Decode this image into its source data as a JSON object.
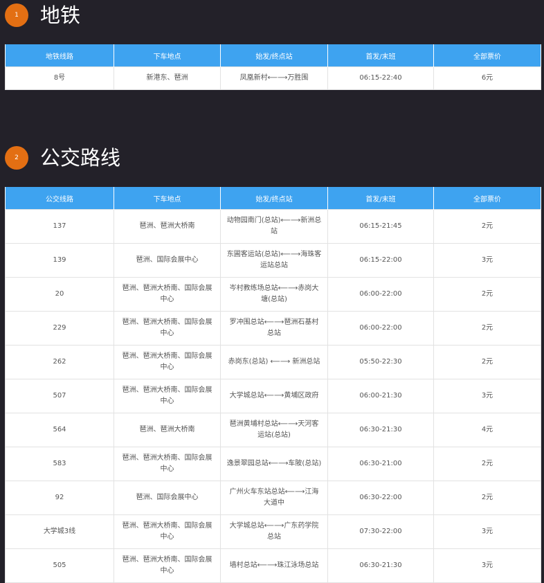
{
  "metro": {
    "badge": "1",
    "title": "地铁",
    "headers": [
      "地铁线路",
      "下车地点",
      "始发/终点站",
      "首发/末班",
      "全部票价"
    ],
    "rows": [
      [
        "8号",
        "新港东、琶洲",
        "凤凰新村⟵⟶万胜围",
        "06:15-22:40",
        "6元"
      ]
    ]
  },
  "bus": {
    "badge": "2",
    "title": "公交路线",
    "headers": [
      "公交线路",
      "下车地点",
      "始发/终点站",
      "首发/末班",
      "全部票价"
    ],
    "rows": [
      [
        "137",
        "琶洲、琶洲大桥南",
        "动物园南门(总站)⟵⟶新洲总站",
        "06:15-21:45",
        "2元"
      ],
      [
        "139",
        "琶洲、国际会展中心",
        "东圃客运站(总站)⟵⟶海珠客运站总站",
        "06:15-22:00",
        "3元"
      ],
      [
        "20",
        "琶洲、琶洲大桥南、国际会展中心",
        "岑村教练场总站⟵⟶赤岗大塘(总站)",
        "06:00-22:00",
        "2元"
      ],
      [
        "229",
        "琶洲、琶洲大桥南、国际会展中心",
        "罗冲围总站⟵⟶琶洲石基村总站",
        "06:00-22:00",
        "2元"
      ],
      [
        "262",
        "琶洲、琶洲大桥南、国际会展中心",
        "赤岗东(总站) ⟵⟶ 新洲总站",
        "05:50-22:30",
        "2元"
      ],
      [
        "507",
        "琶洲、琶洲大桥南、国际会展中心",
        "大学城总站⟵⟶黄埔区政府",
        "06:00-21:30",
        "3元"
      ],
      [
        "564",
        "琶洲、琶洲大桥南",
        "琶洲黄埔村总站⟵⟶天河客运站(总站)",
        "06:30-21:30",
        "4元"
      ],
      [
        "583",
        "琶洲、琶洲大桥南、国际会展中心",
        "逸景翠园总站⟵⟶车陂(总站)",
        "06:30-21:00",
        "2元"
      ],
      [
        "92",
        "琶洲、国际会展中心",
        "广州火车东站总站⟵⟶江海大道中",
        "06:30-22:00",
        "2元"
      ],
      [
        "大学城3线",
        "琶洲、琶洲大桥南、国际会展中心",
        "大学城总站⟵⟶广东药学院总站",
        "07:30-22:00",
        "3元"
      ],
      [
        "505",
        "琶洲、琶洲大桥南、国际会展中心",
        "墙村总站⟵⟶珠江泳场总站",
        "06:30-21:30",
        "3元"
      ]
    ]
  }
}
